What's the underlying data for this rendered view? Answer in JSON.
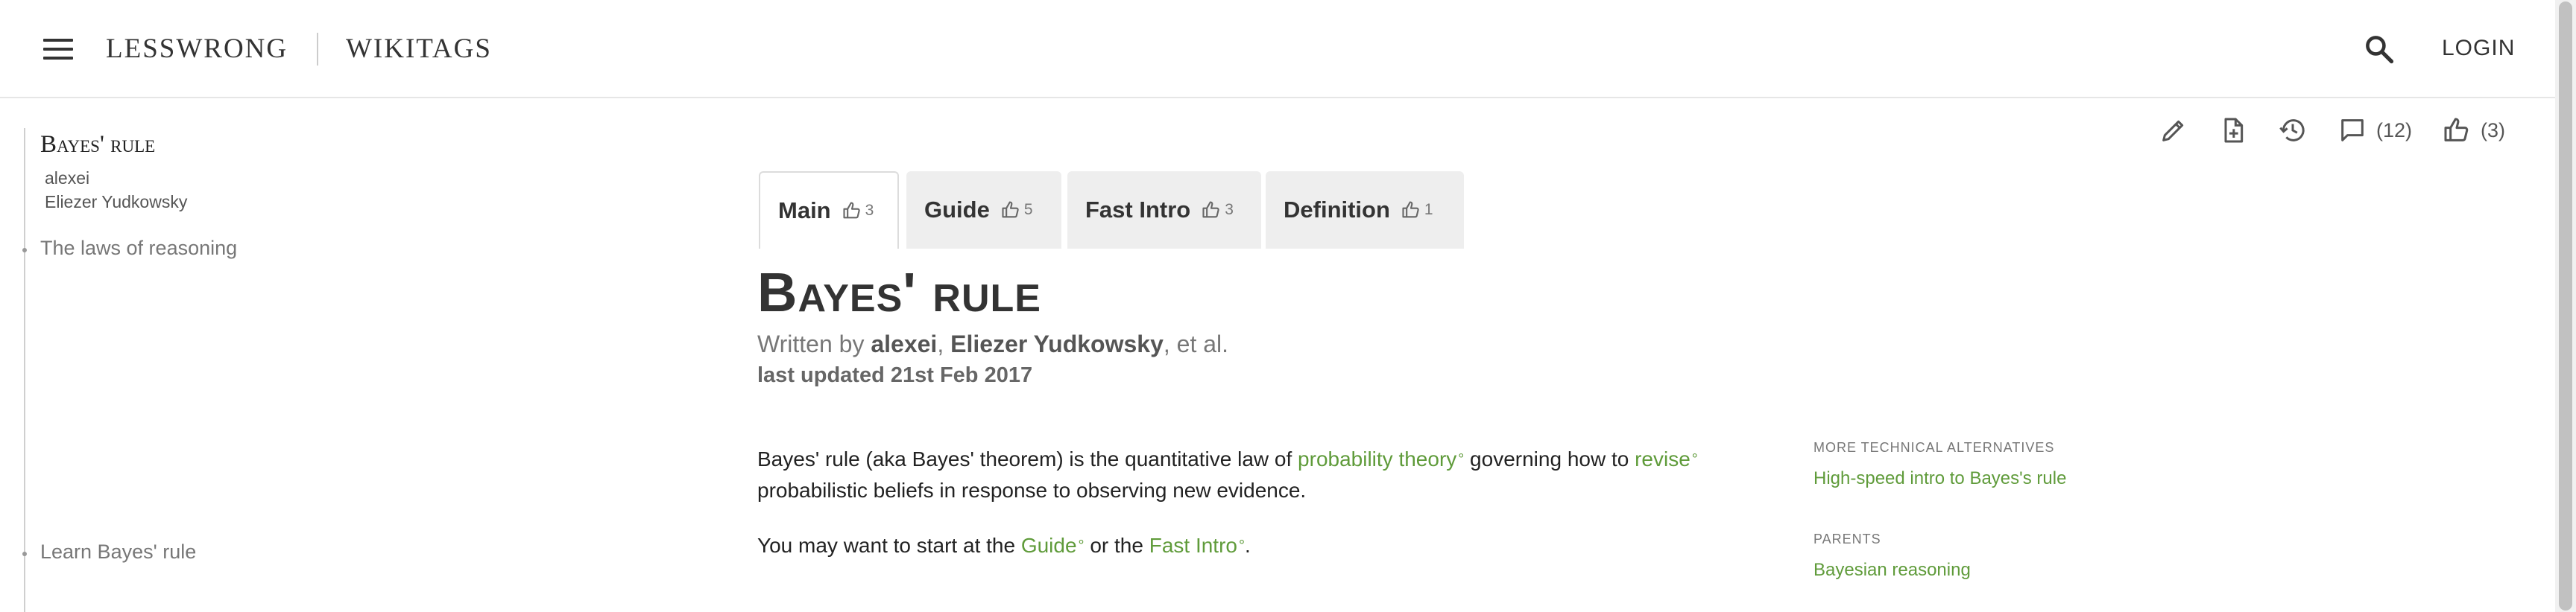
{
  "header": {
    "site_title": "LESSWRONG",
    "section_title": "WIKITAGS",
    "login_label": "LOGIN"
  },
  "toc": {
    "title": "Bayes' rule",
    "authors": [
      "alexei",
      "Eliezer Yudkowsky"
    ],
    "items": [
      "The laws of reasoning",
      "Learn Bayes' rule"
    ]
  },
  "actions": {
    "comment_count": "(12)",
    "like_count": "(3)"
  },
  "tabs": [
    {
      "label": "Main",
      "votes": "3"
    },
    {
      "label": "Guide",
      "votes": "5"
    },
    {
      "label": "Fast Intro",
      "votes": "3"
    },
    {
      "label": "Definition",
      "votes": "1"
    }
  ],
  "page": {
    "title": "Bayes' rule",
    "byline_prefix": "Written by ",
    "author1": "alexei",
    "sep": ", ",
    "author2": "Eliezer Yudkowsky",
    "byline_suffix": ", et al.",
    "updated": "last updated 21st Feb 2017"
  },
  "body": {
    "p1_a": "Bayes' rule (aka Bayes' theorem) is the quantitative law of ",
    "p1_link1": "probability theory",
    "p1_b": " governing how to ",
    "p1_link2": "revise",
    "p1_c": "probabilistic beliefs in response to observing new evidence.",
    "p2_a": "You may want to start at the ",
    "p2_link1": "Guide",
    "p2_b": " or the ",
    "p2_link2": "Fast Intro",
    "p2_c": ".",
    "deg": "°"
  },
  "sidebar": {
    "alternatives_heading": "More technical alternatives",
    "alternatives_link": "High-speed intro to Bayes's rule",
    "parents_heading": "Parents",
    "parents_link": "Bayesian reasoning"
  },
  "colors": {
    "link": "#5f9b3a",
    "tab_bg": "#eeeeee"
  }
}
